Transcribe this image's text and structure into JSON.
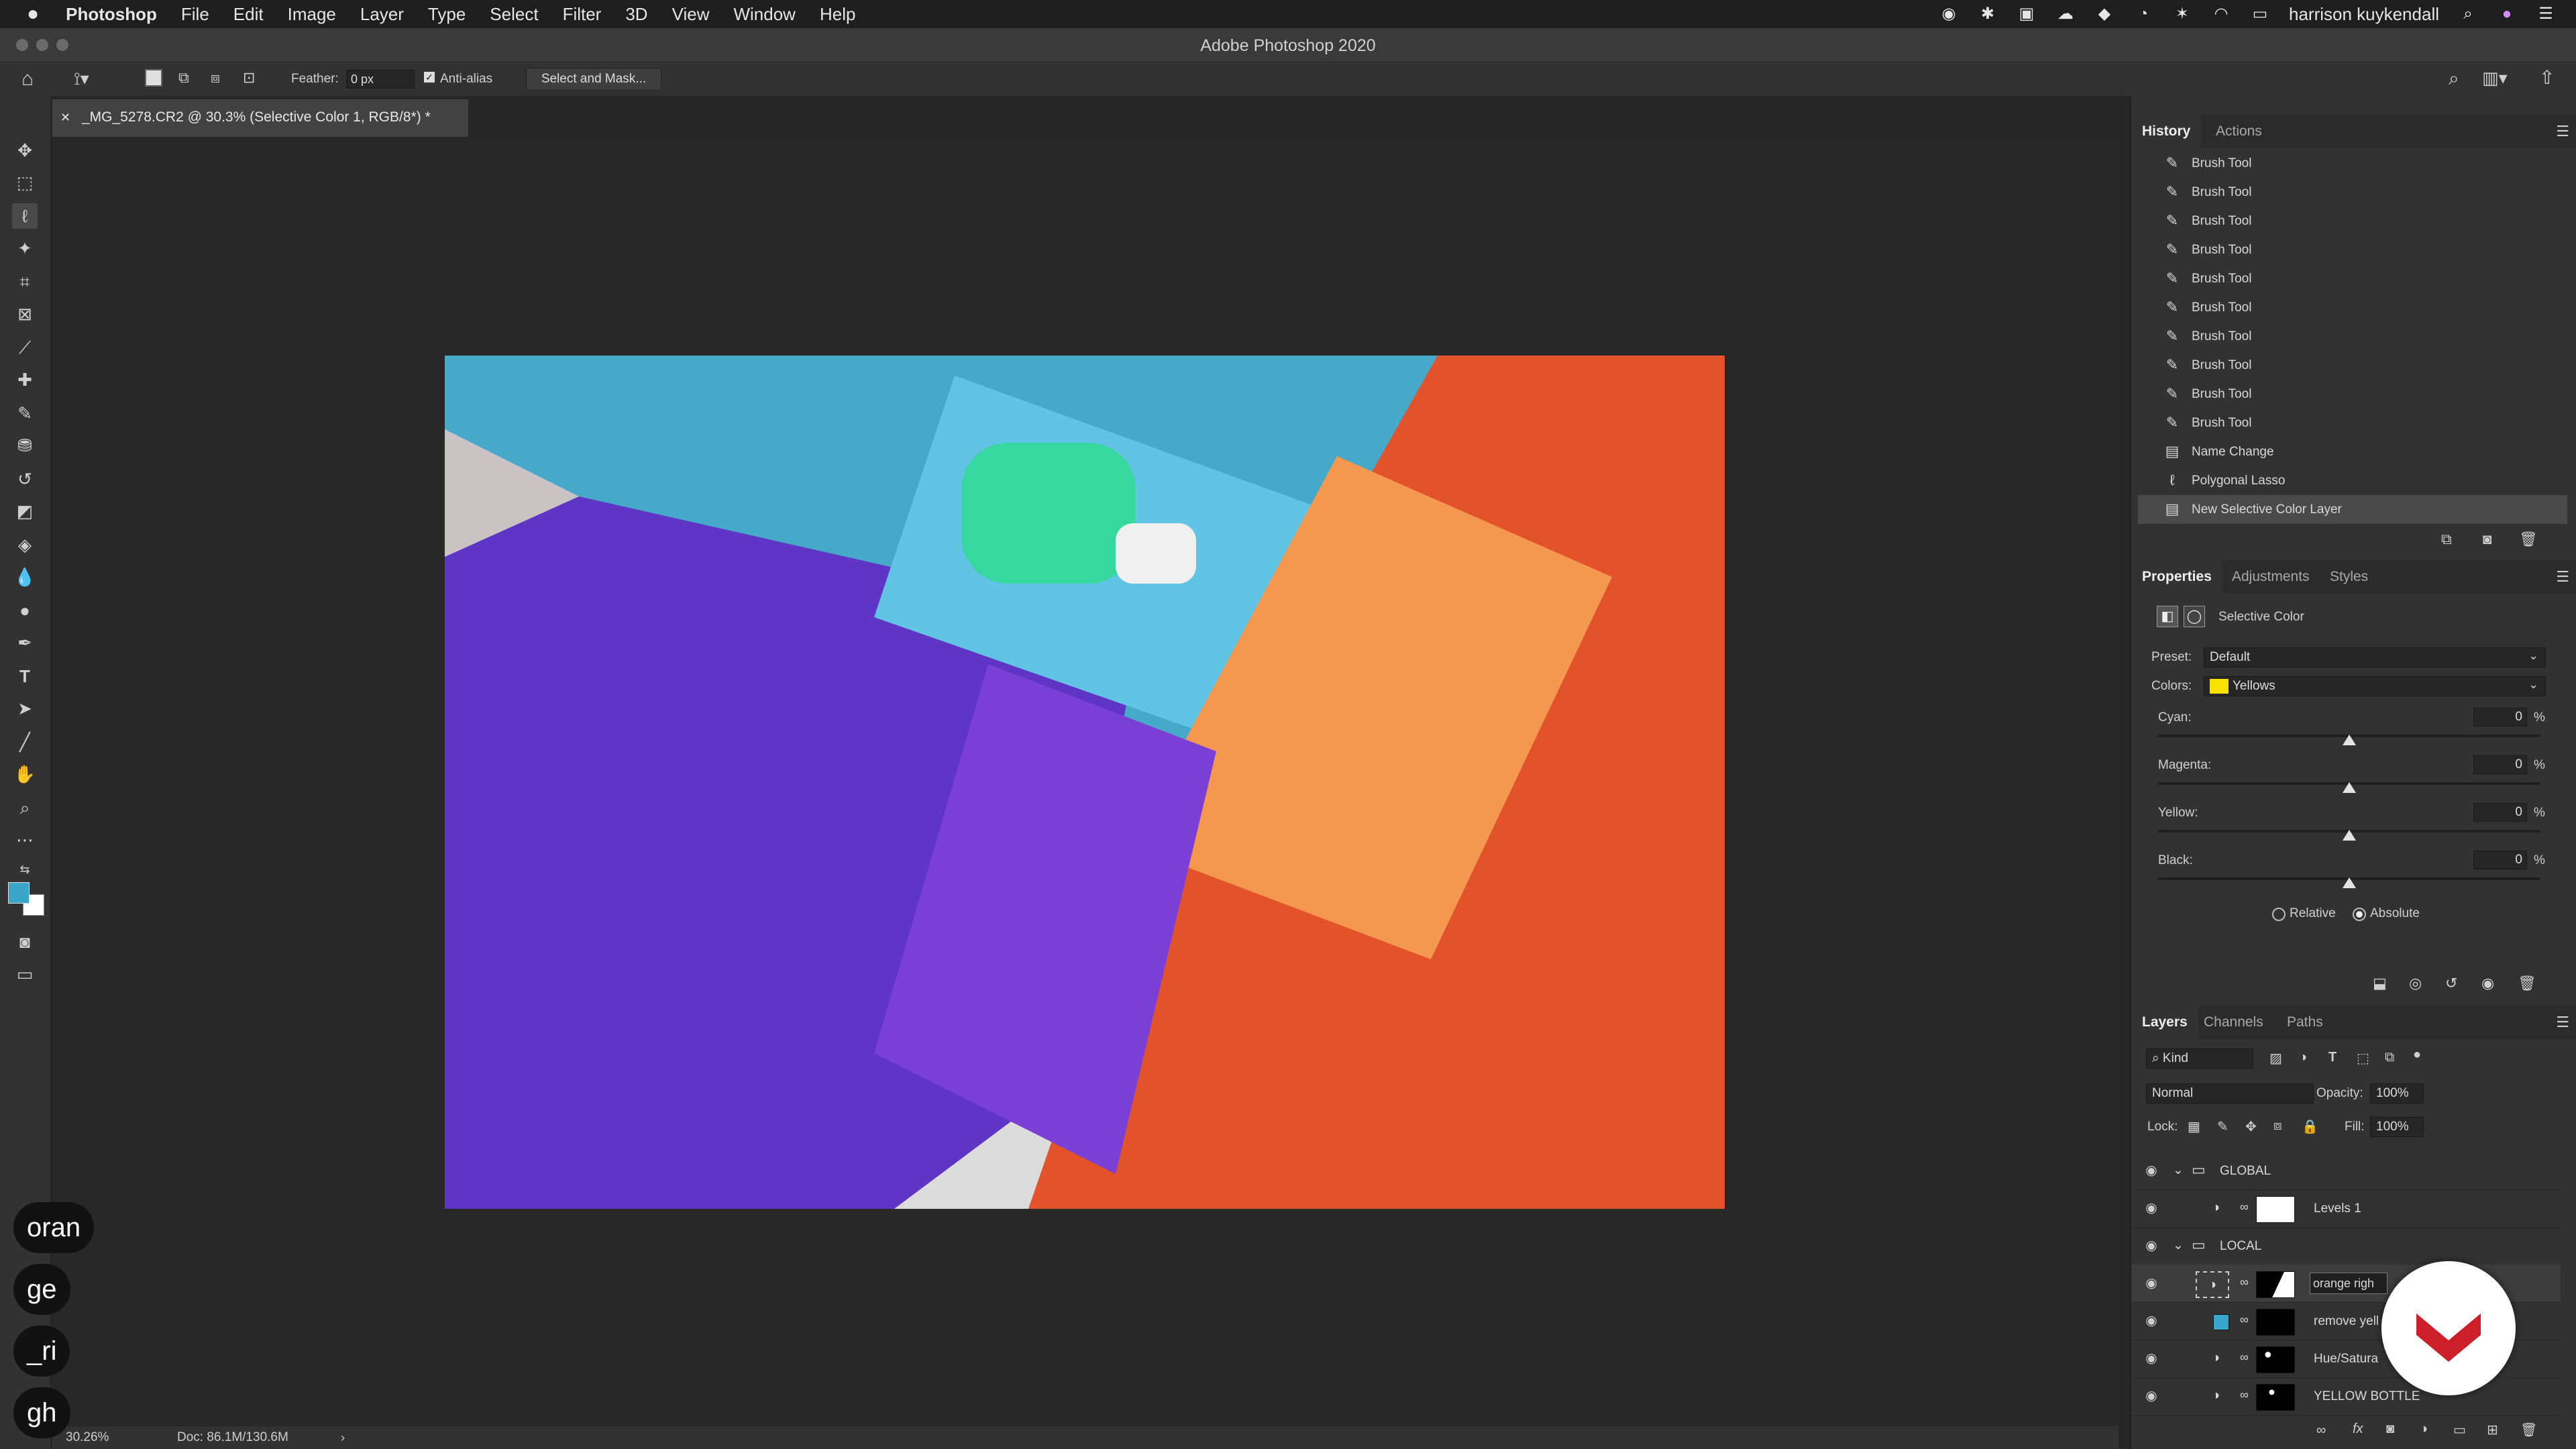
{
  "menubar": {
    "app_name": "Photoshop",
    "items": [
      "File",
      "Edit",
      "Image",
      "Layer",
      "Type",
      "Select",
      "Filter",
      "3D",
      "View",
      "Window",
      "Help"
    ],
    "user": "harrison kuykendall"
  },
  "window": {
    "title": "Adobe Photoshop 2020"
  },
  "options": {
    "feather_label": "Feather:",
    "feather_value": "0 px",
    "antialias_label": "Anti-alias",
    "select_mask_label": "Select and Mask..."
  },
  "document": {
    "tab_title": "_MG_5278.CR2 @ 30.3% (Selective Color 1, RGB/8*) *",
    "zoom": "30.26%",
    "doc_size": "Doc: 86.1M/130.6M"
  },
  "colors": {
    "foreground": "#3aa6c9",
    "background": "#ffffff",
    "accent": "#cc1f2a"
  },
  "history": {
    "tabs": [
      "History",
      "Actions"
    ],
    "items": [
      "Brush Tool",
      "Brush Tool",
      "Brush Tool",
      "Brush Tool",
      "Brush Tool",
      "Brush Tool",
      "Brush Tool",
      "Brush Tool",
      "Brush Tool",
      "Brush Tool",
      "Name Change",
      "Polygonal Lasso",
      "New Selective Color Layer"
    ]
  },
  "properties": {
    "tabs": [
      "Properties",
      "Adjustments",
      "Styles"
    ],
    "title": "Selective Color",
    "preset_label": "Preset:",
    "preset_value": "Default",
    "colors_label": "Colors:",
    "colors_value": "Yellows",
    "sliders": [
      {
        "label": "Cyan:",
        "value": "0",
        "unit": "%"
      },
      {
        "label": "Magenta:",
        "value": "0",
        "unit": "%"
      },
      {
        "label": "Yellow:",
        "value": "0",
        "unit": "%"
      },
      {
        "label": "Black:",
        "value": "0",
        "unit": "%"
      }
    ],
    "relative_label": "Relative",
    "absolute_label": "Absolute"
  },
  "layers": {
    "tabs": [
      "Layers",
      "Channels",
      "Paths"
    ],
    "kind_label": "Kind",
    "blend_mode": "Normal",
    "opacity_label": "Opacity:",
    "opacity_value": "100%",
    "lock_label": "Lock:",
    "fill_label": "Fill:",
    "fill_value": "100%",
    "items": [
      {
        "name": "GLOBAL",
        "type": "group"
      },
      {
        "name": "Levels 1",
        "type": "adjustment"
      },
      {
        "name": "LOCAL",
        "type": "group"
      },
      {
        "name": "orange righ",
        "type": "adjustment"
      },
      {
        "name": "remove yell",
        "type": "fill"
      },
      {
        "name": "Hue/Satura",
        "type": "adjustment"
      },
      {
        "name": "YELLOW BOTTLE",
        "type": "adjustment"
      }
    ]
  },
  "captions": [
    "oran",
    "ge",
    "_ri",
    "gh"
  ]
}
